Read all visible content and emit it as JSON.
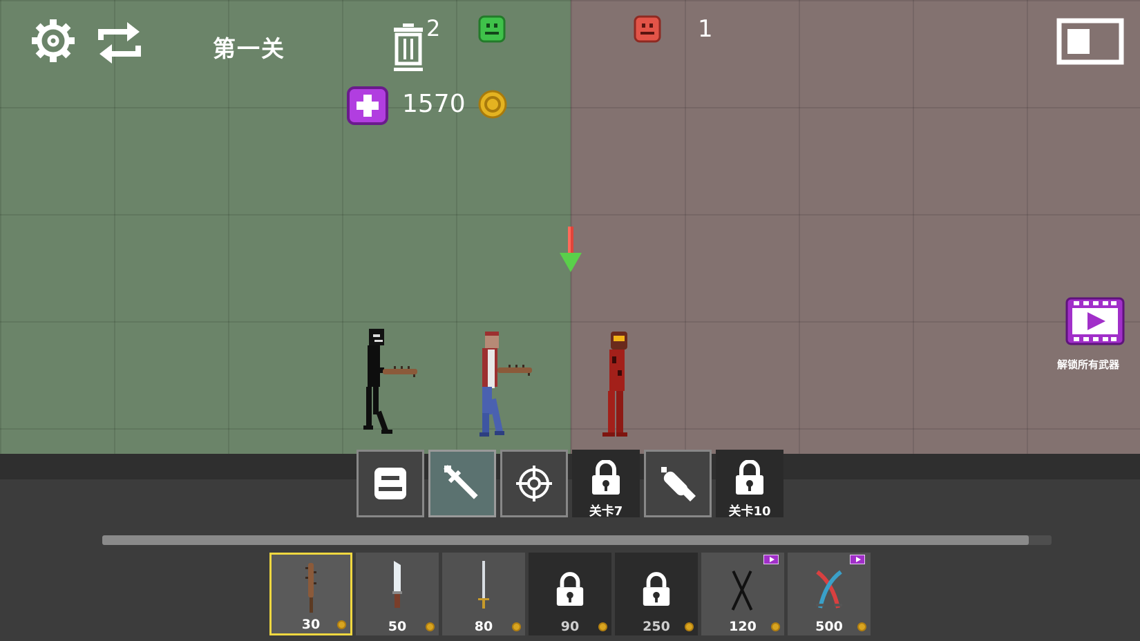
{
  "hud": {
    "level_title": "第一关",
    "trash_count": "2",
    "red_team_count": "1",
    "coins": "1570",
    "unlock_all_label": "解锁所有武器"
  },
  "categories": [
    {
      "name": "character",
      "icon": "character-face-icon",
      "active": false,
      "locked": false
    },
    {
      "name": "melee",
      "icon": "sword-icon",
      "active": true,
      "locked": false
    },
    {
      "name": "guns",
      "icon": "crosshair-icon",
      "active": false,
      "locked": false
    },
    {
      "name": "level7",
      "icon": "lock-icon",
      "label": "关卡7",
      "locked": true
    },
    {
      "name": "explosives",
      "icon": "bomb-icon",
      "active": false,
      "locked": false
    },
    {
      "name": "level10",
      "icon": "lock-icon",
      "label": "关卡10",
      "locked": true
    }
  ],
  "weapons": [
    {
      "icon": "spiked-bat-icon",
      "price": "30",
      "selected": true,
      "locked": false
    },
    {
      "icon": "knife-icon",
      "price": "50",
      "locked": false
    },
    {
      "icon": "sword-icon",
      "price": "80",
      "locked": false
    },
    {
      "icon": "lock-icon",
      "price": "90",
      "locked": true
    },
    {
      "icon": "lock-icon",
      "price": "250",
      "locked": true
    },
    {
      "icon": "crossed-blades-icon",
      "price": "120",
      "locked": false,
      "ad": true
    },
    {
      "icon": "crossed-swords-icon",
      "price": "500",
      "locked": false,
      "ad": true
    }
  ],
  "scrollbar": {
    "fraction_visible": 0.976
  },
  "colors": {
    "green_side": "#6b8469",
    "red_side": "#837270",
    "accent_purple": "#a12fc9",
    "selected_border": "#f0d840",
    "coin": "#d9a520"
  }
}
